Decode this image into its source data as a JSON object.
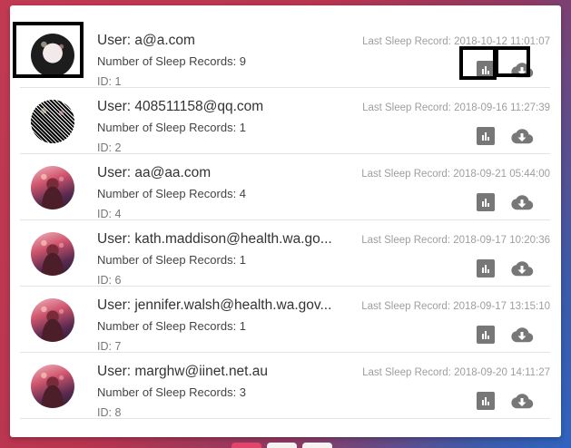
{
  "users": [
    {
      "user": "User: a@a.com",
      "records": "Number of Sleep Records: 9",
      "id": "ID: 1",
      "last": "Last Sleep Record: 2018-10-12 11:01:07",
      "avatar": "dark"
    },
    {
      "user": "User: 408511158@qq.com",
      "records": "Number of Sleep Records: 1",
      "id": "ID: 2",
      "last": "Last Sleep Record: 2018-09-16 11:27:39",
      "avatar": "noise"
    },
    {
      "user": "User: aa@aa.com",
      "records": "Number of Sleep Records: 4",
      "id": "ID: 4",
      "last": "Last Sleep Record: 2018-09-21 05:44:00",
      "avatar": "photo"
    },
    {
      "user": "User: kath.maddison@health.wa.go...",
      "records": "Number of Sleep Records: 1",
      "id": "ID: 6",
      "last": "Last Sleep Record: 2018-09-17 10:20:36",
      "avatar": "photo"
    },
    {
      "user": "User: jennifer.walsh@health.wa.gov...",
      "records": "Number of Sleep Records: 1",
      "id": "ID: 7",
      "last": "Last Sleep Record: 2018-09-17 13:15:10",
      "avatar": "photo"
    },
    {
      "user": "User: marghw@iinet.net.au",
      "records": "Number of Sleep Records: 3",
      "id": "ID: 8",
      "last": "Last Sleep Record: 2018-09-20 14:11:27",
      "avatar": "photo"
    }
  ],
  "icons": {
    "chart": "bar-chart-icon",
    "download": "cloud-download-icon"
  },
  "colors": {
    "icon": "#777777",
    "divider": "#e3e3e3",
    "highlight": "#000000"
  }
}
